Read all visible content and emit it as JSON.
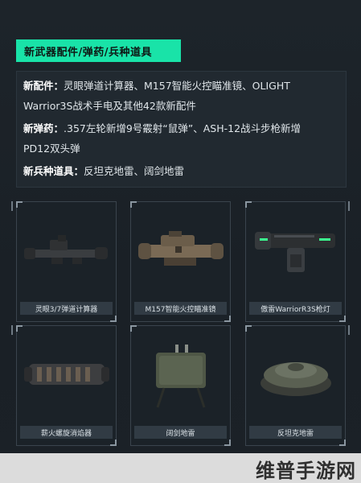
{
  "header": {
    "title": "新武器配件/弹药/兵种道具"
  },
  "info": {
    "lines": [
      {
        "label": "新配件：",
        "text": "灵眼弹道计算器、M157智能火控瞄准镜、OLIGHT"
      },
      {
        "label": "",
        "text": "Warrior3S战术手电及其他42款新配件"
      },
      {
        "label": "新弹药：",
        "text": ".357左轮新增9号霰射“鼠弹”、ASH-12战斗步枪新增"
      },
      {
        "label": "",
        "text": "PD12双头弹"
      },
      {
        "label": "新兵种道具：",
        "text": "反坦克地雷、阔剑地雷"
      }
    ]
  },
  "items": [
    {
      "caption": "灵眼3/7弹道计算器",
      "icon": "scope-icon"
    },
    {
      "caption": "M157智能火控瞄准镜",
      "icon": "smart-scope-icon"
    },
    {
      "caption": "傲雷WarriorR3S枪灯",
      "icon": "flashlight-icon"
    },
    {
      "caption": "薪火螺旋消焰器",
      "icon": "flash-hider-icon"
    },
    {
      "caption": "阔剑地雷",
      "icon": "claymore-mine-icon"
    },
    {
      "caption": "反坦克地雷",
      "icon": "antitank-mine-icon"
    }
  ],
  "watermark": {
    "text": "维普手游网"
  },
  "colors": {
    "accent": "#19e3a8",
    "background": "#1c2228"
  }
}
